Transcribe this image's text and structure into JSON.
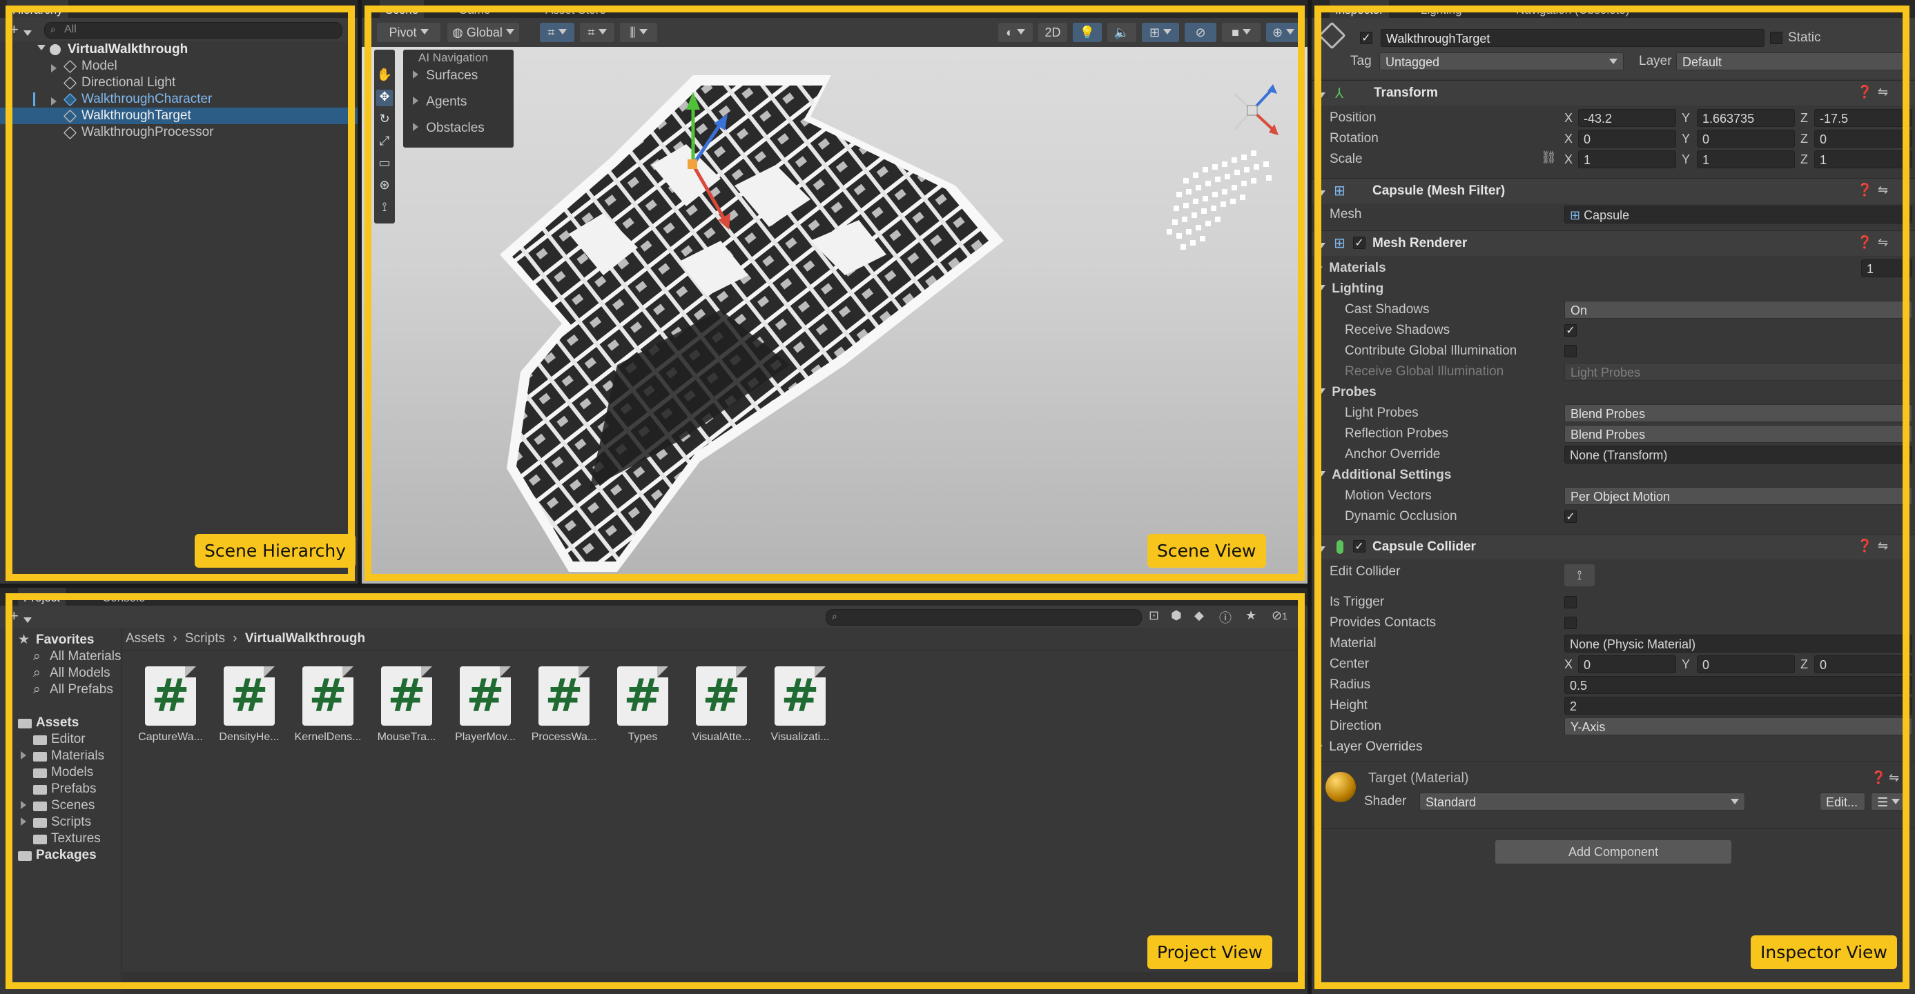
{
  "hierarchy": {
    "tab": "Hierarchy",
    "search_placeholder": "All",
    "root": "VirtualWalkthrough",
    "items": [
      "Model",
      "Directional Light",
      "WalkthroughCharacter",
      "WalkthroughTarget",
      "WalkthroughProcessor"
    ],
    "selected": "WalkthroughTarget",
    "region_label": "Scene Hierarchy"
  },
  "scene": {
    "tabs": [
      "Scene",
      "Game",
      "Asset Store"
    ],
    "toolbar": {
      "pivot": "Pivot",
      "global": "Global",
      "mode_2d": "2D"
    },
    "ai_nav": {
      "title": "AI Navigation",
      "items": [
        "Surfaces",
        "Agents",
        "Obstacles"
      ]
    },
    "region_label": "Scene View"
  },
  "project": {
    "tabs": [
      "Project",
      "Console"
    ],
    "favorites": {
      "title": "Favorites",
      "items": [
        "All Materials",
        "All Models",
        "All Prefabs"
      ]
    },
    "assets": {
      "title": "Assets",
      "items": [
        "Editor",
        "Materials",
        "Models",
        "Prefabs",
        "Scenes",
        "Scripts",
        "Textures"
      ]
    },
    "packages": "Packages",
    "breadcrumb": [
      "Assets",
      "Scripts",
      "VirtualWalkthrough"
    ],
    "scripts": [
      "CaptureWa...",
      "DensityHe...",
      "KernelDens...",
      "MouseTra...",
      "PlayerMov...",
      "ProcessWa...",
      "Types",
      "VisualAtte...",
      "Visualizati..."
    ],
    "hidden_count": "1",
    "region_label": "Project View"
  },
  "inspector": {
    "tabs": [
      "Inspector",
      "Lighting",
      "Navigation (Obsolete)"
    ],
    "object_name": "WalkthroughTarget",
    "static_label": "Static",
    "tag_label": "Tag",
    "tag_value": "Untagged",
    "layer_label": "Layer",
    "layer_value": "Default",
    "transform": {
      "title": "Transform",
      "position_label": "Position",
      "position": {
        "x": "-43.2",
        "y": "1.663735",
        "z": "-17.5"
      },
      "rotation_label": "Rotation",
      "rotation": {
        "x": "0",
        "y": "0",
        "z": "0"
      },
      "scale_label": "Scale",
      "scale": {
        "x": "1",
        "y": "1",
        "z": "1"
      }
    },
    "mesh_filter": {
      "title": "Capsule (Mesh Filter)",
      "mesh_label": "Mesh",
      "mesh_value": "Capsule"
    },
    "mesh_renderer": {
      "title": "Mesh Renderer",
      "materials_label": "Materials",
      "materials_count": "1",
      "lighting": "Lighting",
      "cast_shadows_label": "Cast Shadows",
      "cast_shadows_value": "On",
      "receive_shadows_label": "Receive Shadows",
      "contribute_gi_label": "Contribute Global Illumination",
      "receive_gi_label": "Receive Global Illumination",
      "receive_gi_value": "Light Probes",
      "probes": "Probes",
      "light_probes_label": "Light Probes",
      "light_probes_value": "Blend Probes",
      "reflection_probes_label": "Reflection Probes",
      "reflection_probes_value": "Blend Probes",
      "anchor_override_label": "Anchor Override",
      "anchor_override_value": "None (Transform)",
      "additional": "Additional Settings",
      "motion_vectors_label": "Motion Vectors",
      "motion_vectors_value": "Per Object Motion",
      "dynamic_occlusion_label": "Dynamic Occlusion"
    },
    "capsule_collider": {
      "title": "Capsule Collider",
      "edit_collider_label": "Edit Collider",
      "is_trigger_label": "Is Trigger",
      "provides_contacts_label": "Provides Contacts",
      "material_label": "Material",
      "material_value": "None (Physic Material)",
      "center_label": "Center",
      "center": {
        "x": "0",
        "y": "0",
        "z": "0"
      },
      "radius_label": "Radius",
      "radius": "0.5",
      "height_label": "Height",
      "height": "2",
      "direction_label": "Direction",
      "direction": "Y-Axis",
      "layer_overrides": "Layer Overrides"
    },
    "material": {
      "title": "Target (Material)",
      "shader_label": "Shader",
      "shader_value": "Standard",
      "edit_label": "Edit..."
    },
    "add_component": "Add Component",
    "region_label": "Inspector View"
  },
  "axis_letters": {
    "x": "X",
    "y": "Y",
    "z": "Z"
  },
  "colors": {
    "highlight": "#f7c51c",
    "selection": "#2c5d87",
    "accent_blue": "#5dabef"
  }
}
